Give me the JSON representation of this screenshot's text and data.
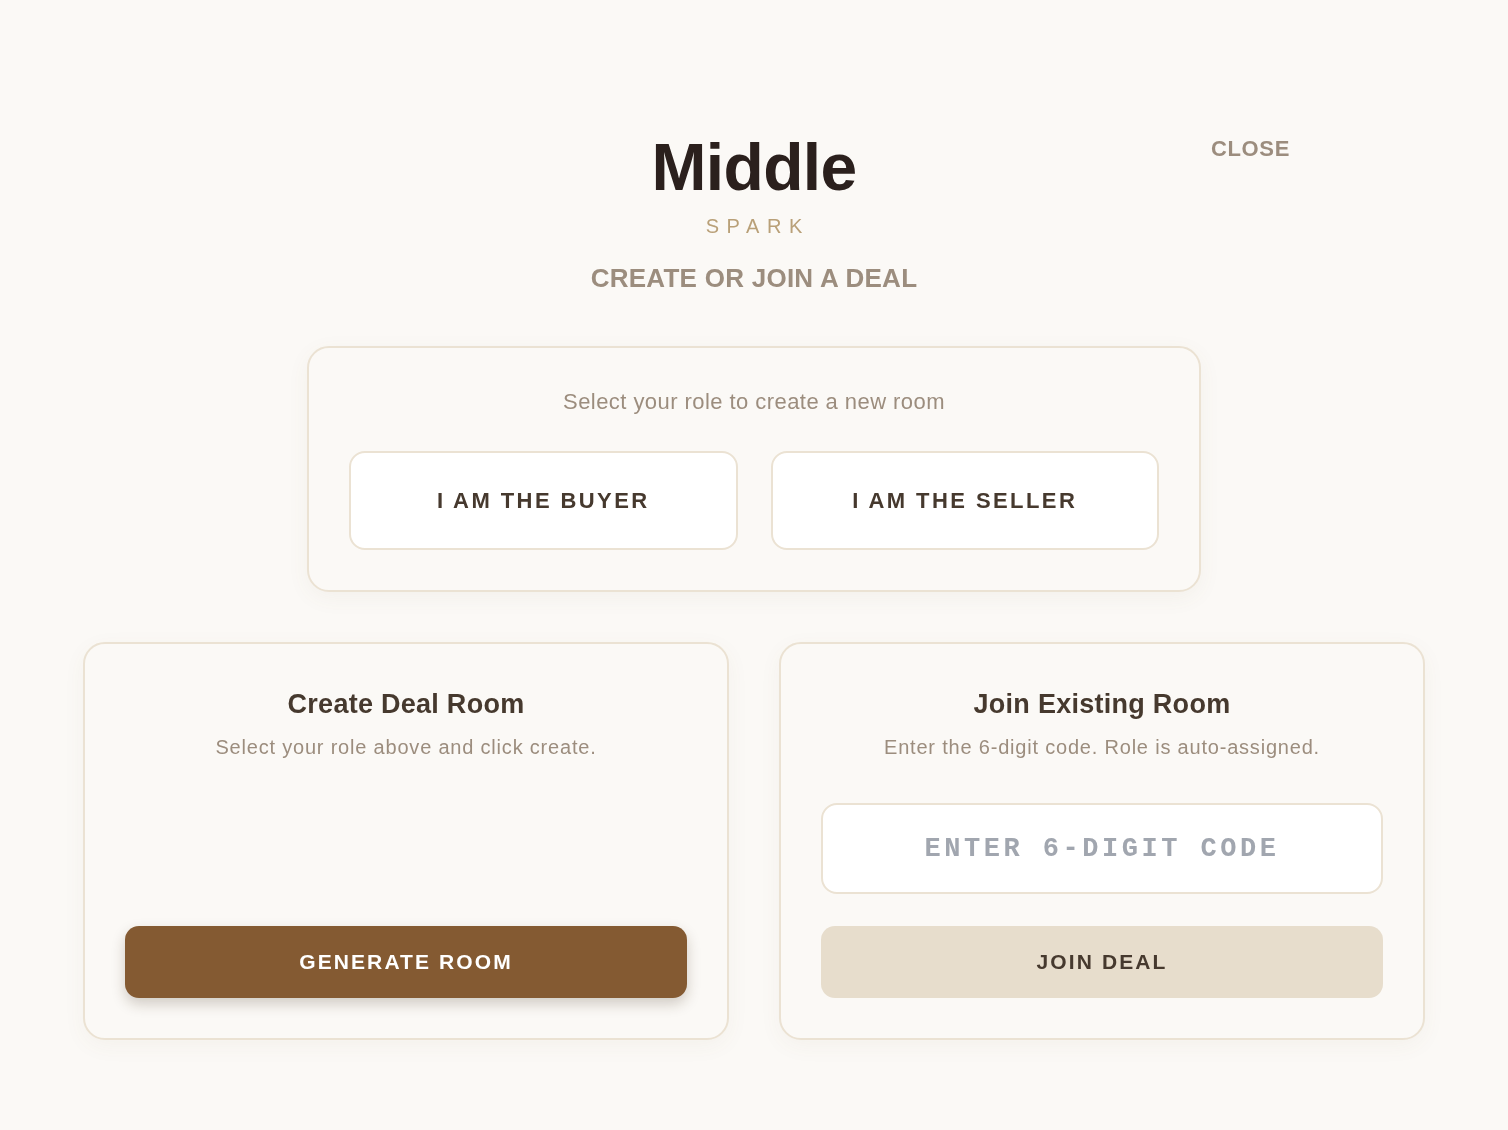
{
  "logo": {
    "wordmark": "Middle",
    "tagline": "SPARK"
  },
  "close_button": "CLOSE",
  "heading": "CREATE OR JOIN A DEAL",
  "role_panel": {
    "prompt": "Select your role to create a new room",
    "roles": [
      {
        "label": "I AM THE BUYER",
        "selected": false
      },
      {
        "label": "I AM THE SELLER",
        "selected": false
      }
    ]
  },
  "cards": [
    {
      "kind": "create",
      "title": "Create Deal Room",
      "description": "Select your role above and click create.",
      "button": "GENERATE ROOM"
    },
    {
      "kind": "join",
      "title": "Join Existing Room",
      "description": "Enter the 6-digit code. Role is auto-assigned.",
      "code_field": {
        "placeholder": "ENTER 6-DIGIT CODE"
      },
      "button": "JOIN DEAL"
    }
  ]
}
